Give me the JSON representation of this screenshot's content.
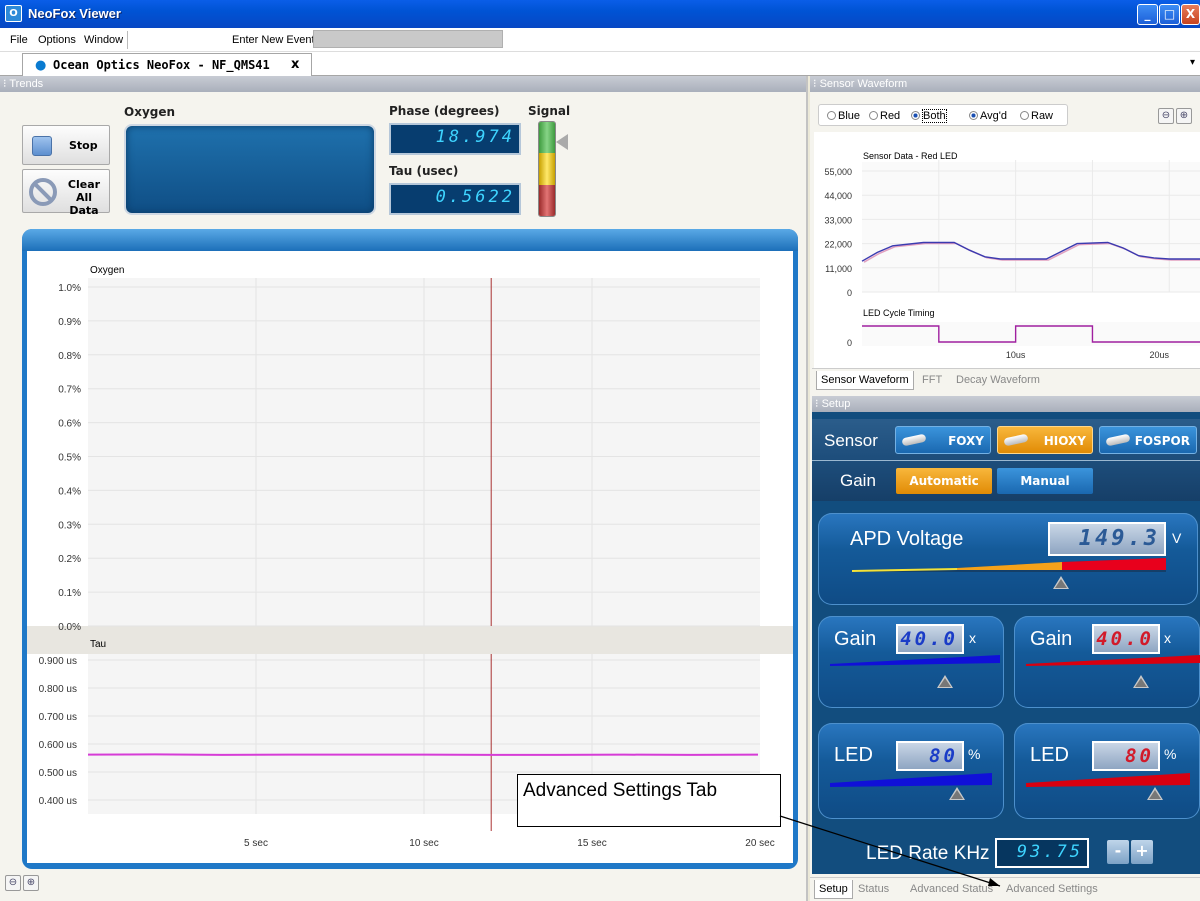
{
  "window": {
    "title": "NeoFox Viewer",
    "min": "_",
    "max": "□",
    "close": "X"
  },
  "menu": {
    "file": "File",
    "options": "Options",
    "window": "Window",
    "event_label": "Enter New Event:",
    "event_value": ""
  },
  "doc_tab": {
    "label": "Ocean Optics NeoFox - NF_QMS41",
    "close": "x"
  },
  "trends": {
    "header": "Trends",
    "stop_label": "Stop",
    "clear_label": "Clear All Data",
    "oxygen_label": "Oxygen",
    "phase_label": "Phase (degrees)",
    "phase_value": "18.974",
    "tau_label": "Tau (usec)",
    "tau_value": "0.5622",
    "signal_label": "Signal"
  },
  "chart_data": [
    {
      "type": "line",
      "title": "Oxygen",
      "xlabel": "",
      "ylabel": "",
      "y_ticks": [
        "1.0%",
        "0.9%",
        "0.8%",
        "0.7%",
        "0.6%",
        "0.5%",
        "0.4%",
        "0.3%",
        "0.2%",
        "0.1%",
        "0.0%"
      ],
      "ylim": [
        0,
        1.0
      ],
      "x_ticks": [
        "5 sec",
        "10 sec",
        "15 sec",
        "20 sec"
      ],
      "xlim": [
        0,
        20
      ],
      "cursor_x": 12,
      "series": []
    },
    {
      "type": "line",
      "title": "Tau",
      "y_ticks": [
        "0.900 us",
        "0.800 us",
        "0.700 us",
        "0.600 us",
        "0.500 us",
        "0.400 us"
      ],
      "ylim": [
        0.35,
        0.92
      ],
      "xlim": [
        0,
        20
      ],
      "cursor_x": 12,
      "series": [
        {
          "color": "#d63cd6",
          "x": [
            0,
            2,
            4,
            6,
            8,
            10,
            12,
            14,
            16,
            18,
            20
          ],
          "y": [
            0.562,
            0.563,
            0.561,
            0.562,
            0.562,
            0.562,
            0.561,
            0.561,
            0.562,
            0.561,
            0.562
          ]
        }
      ]
    },
    {
      "type": "line",
      "title": "Sensor Data - Red LED",
      "y_ticks": [
        "55,000",
        "44,000",
        "33,000",
        "22,000",
        "11,000",
        "0"
      ],
      "ylim": [
        0,
        60000
      ],
      "xlim": [
        0,
        22
      ],
      "series": [
        {
          "color": "#3b3bb0",
          "x": [
            0,
            1,
            2,
            4,
            6,
            7,
            8,
            9,
            10,
            12,
            14,
            16,
            17,
            18,
            19,
            20,
            22
          ],
          "y": [
            14000,
            18000,
            21000,
            22500,
            22500,
            19000,
            16000,
            15000,
            15000,
            15000,
            22000,
            22500,
            20000,
            16500,
            15500,
            15000,
            15000
          ]
        }
      ]
    },
    {
      "type": "line",
      "title": "LED Cycle Timing",
      "y_ticks": [
        "0"
      ],
      "x_ticks": [
        "10us",
        "20us"
      ],
      "xlim": [
        0,
        22
      ],
      "series": [
        {
          "color": "#a020a0",
          "x": [
            0,
            5,
            5,
            10,
            10,
            15,
            15,
            22
          ],
          "y": [
            1,
            1,
            0,
            0,
            1,
            1,
            0,
            0
          ]
        }
      ]
    }
  ],
  "waveform": {
    "header": "Sensor Waveform",
    "radios": [
      "Blue",
      "Red",
      "Both",
      "Avg'd",
      "Raw"
    ],
    "tabs": [
      "Sensor Waveform",
      "FFT",
      "Decay Waveform"
    ]
  },
  "setup": {
    "header": "Setup",
    "sensor_label": "Sensor",
    "sensors": [
      "FOXY",
      "HIOXY",
      "FOSPOR"
    ],
    "gain_label": "Gain",
    "gain_auto": "Automatic",
    "gain_manual": "Manual",
    "apd_label": "APD Voltage",
    "apd_value": "149.3",
    "apd_unit": "V",
    "gain_left_label": "Gain",
    "gain_left_value": "40.0",
    "gain_left_unit": "x",
    "gain_right_label": "Gain",
    "gain_right_value": "40.0",
    "gain_right_unit": "x",
    "led_left_label": "LED",
    "led_left_value": "80",
    "led_left_unit": "%",
    "led_right_label": "LED",
    "led_right_value": "80",
    "led_right_unit": "%",
    "rate_label": "LED Rate KHz",
    "rate_value": "93.75",
    "minus": "-",
    "plus": "+",
    "tabs": [
      "Setup",
      "Status",
      "Advanced Status",
      "Advanced Settings"
    ]
  },
  "callout": "Advanced Settings Tab",
  "colors": {
    "accent": "#1f78c7",
    "tau_line": "#d63cd6",
    "apd_red": "#e8001c"
  }
}
